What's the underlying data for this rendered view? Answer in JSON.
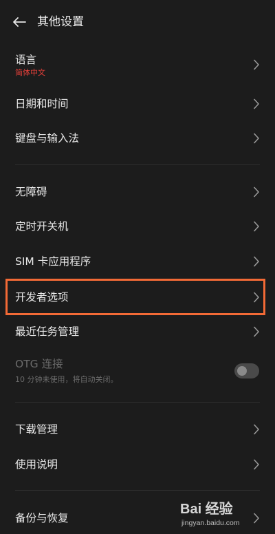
{
  "header": {
    "title": "其他设置",
    "back_icon": "arrow-left-icon"
  },
  "colors": {
    "background": "#1c1c1c",
    "accent_subtitle": "#e8403a",
    "highlight_border": "#f36a36",
    "disabled_text": "#6b6b6b"
  },
  "rows": {
    "language": {
      "label": "语言",
      "value": "简体中文"
    },
    "datetime": {
      "label": "日期和时间"
    },
    "keyboard": {
      "label": "键盘与输入法"
    },
    "accessibility": {
      "label": "无障碍"
    },
    "schedule_power": {
      "label": "定时开关机"
    },
    "sim_apps": {
      "label": "SIM 卡应用程序"
    },
    "developer": {
      "label": "开发者选项"
    },
    "recent_tasks": {
      "label": "最近任务管理"
    },
    "otg": {
      "label": "OTG 连接",
      "description": "10 分钟未使用，将自动关闭。",
      "enabled": false
    },
    "downloads": {
      "label": "下载管理"
    },
    "manual": {
      "label": "使用说明"
    },
    "backup": {
      "label": "备份与恢复"
    }
  },
  "watermark": {
    "main": "Bai 经验",
    "sub": "jingyan.baidu.com"
  }
}
